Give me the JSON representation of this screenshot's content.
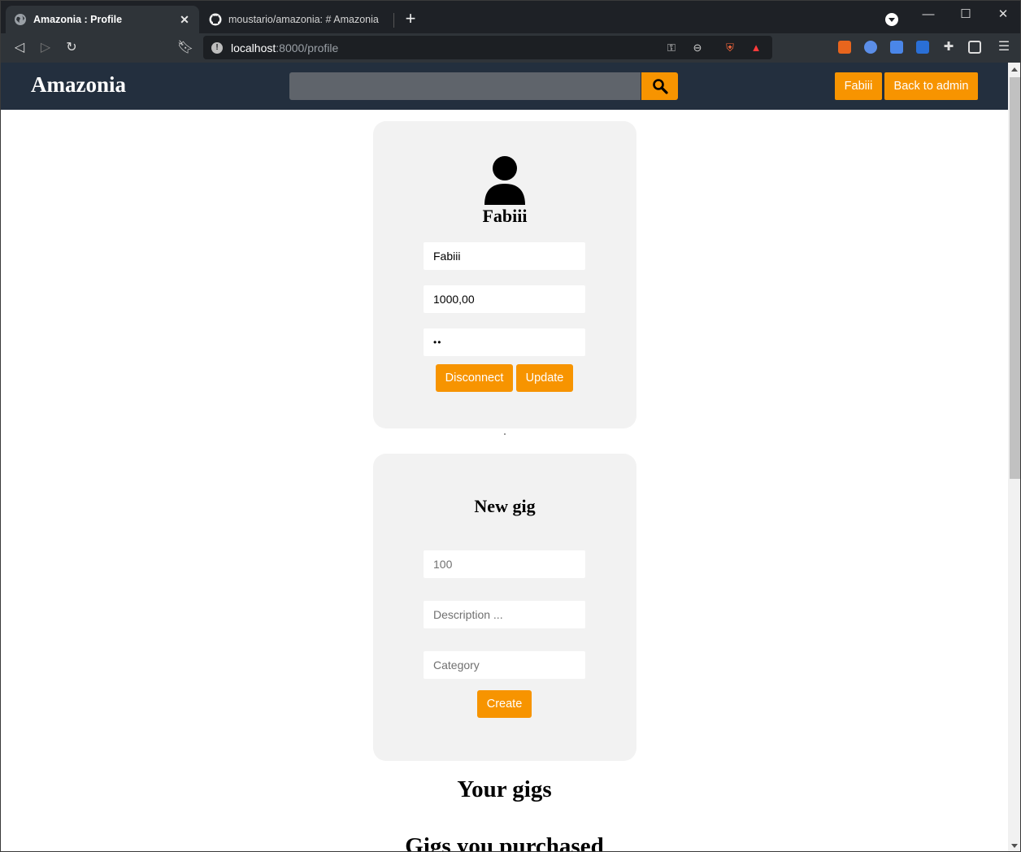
{
  "browser": {
    "tabs": [
      {
        "title": "Amazonia : Profile",
        "active": true
      },
      {
        "title": "moustario/amazonia: # Amazonia",
        "active": false
      }
    ],
    "url_host": "localhost",
    "url_path": ":8000/profile"
  },
  "header": {
    "brand": "Amazonia",
    "search_placeholder": "",
    "user_button": "Fabiii",
    "admin_button": "Back to admin"
  },
  "profile": {
    "username": "Fabiii",
    "name_value": "Fabiii",
    "balance_value": "1000,00",
    "password_value": "••",
    "disconnect_label": "Disconnect",
    "update_label": "Update"
  },
  "new_gig": {
    "title": "New gig",
    "price_placeholder": "100",
    "description_placeholder": "Description ...",
    "category_placeholder": "Category",
    "create_label": "Create"
  },
  "sections": {
    "your_gigs": "Your gigs",
    "purchased": "Gigs you purchased"
  },
  "colors": {
    "accent": "#f79400",
    "header_bg": "#232f3e",
    "card_bg": "#f2f2f2"
  }
}
